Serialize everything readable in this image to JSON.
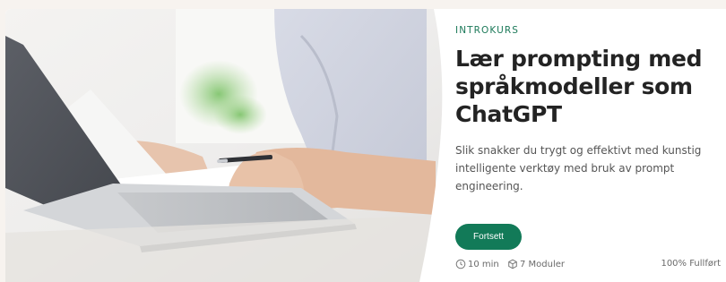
{
  "course": {
    "eyebrow": "INTROKURS",
    "title": "Lær prompting med språkmodeller som ChatGPT",
    "description": "Slik snakker du trygt og effektivt med kunstig intelligente verktøy  med bruk av prompt engineering.",
    "cta_label": "Fortsett",
    "duration": "10 min",
    "modules": "7 Moduler",
    "progress": "100% Fullført",
    "progress_value": 1.0
  },
  "icons": {
    "duration": "clock-icon",
    "modules": "cube-icon"
  },
  "colors": {
    "accent": "#127a58",
    "eyebrow": "#1d7a5a",
    "title": "#232323",
    "body": "#555555",
    "page_background": "#f7f3ef"
  }
}
